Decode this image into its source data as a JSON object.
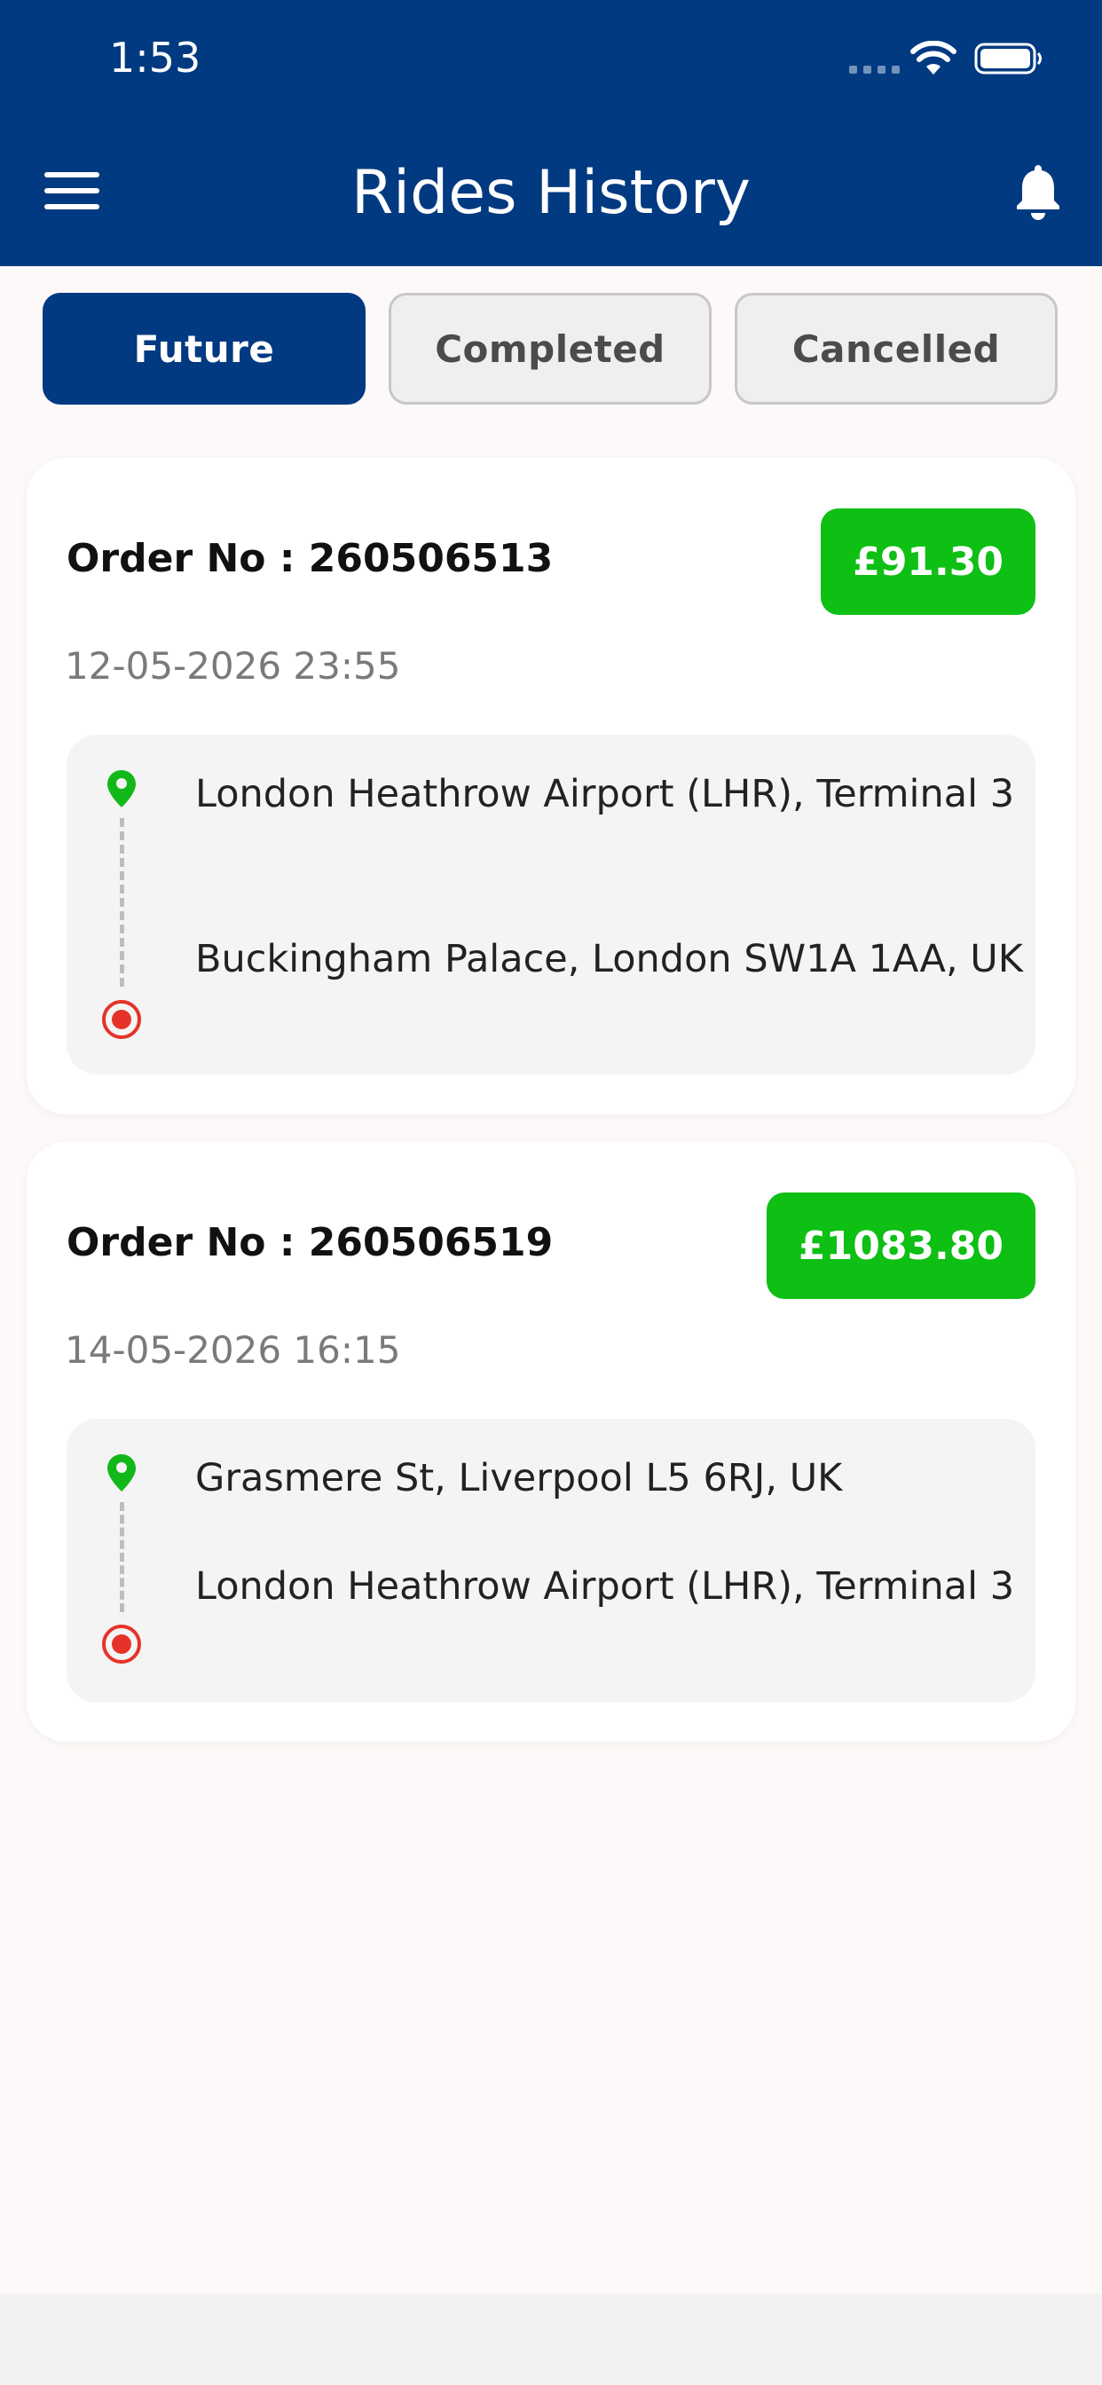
{
  "status_bar": {
    "time": "1:53"
  },
  "header": {
    "title": "Rides History",
    "menu_icon": "hamburger-menu-icon",
    "notification_icon": "bell-icon"
  },
  "tabs": [
    {
      "label": "Future",
      "active": true
    },
    {
      "label": "Completed",
      "active": false
    },
    {
      "label": "Cancelled",
      "active": false
    }
  ],
  "rides": [
    {
      "order_label": "Order No : 260506513",
      "price": "£91.30",
      "datetime": "12-05-2026 23:55",
      "pickup": "London Heathrow Airport (LHR), Terminal 3",
      "dropoff": "Buckingham Palace, London SW1A 1AA, UK"
    },
    {
      "order_label": "Order No : 260506519",
      "price": "£1083.80",
      "datetime": "14-05-2026 16:15",
      "pickup": "Grasmere St, Liverpool L5 6RJ, UK",
      "dropoff": "London Heathrow Airport (LHR), Terminal 3"
    }
  ],
  "colors": {
    "brand": "#013a81",
    "price_badge": "#0ebf14",
    "pickup_pin": "#12b81a",
    "dropoff_pin": "#e5332a"
  }
}
